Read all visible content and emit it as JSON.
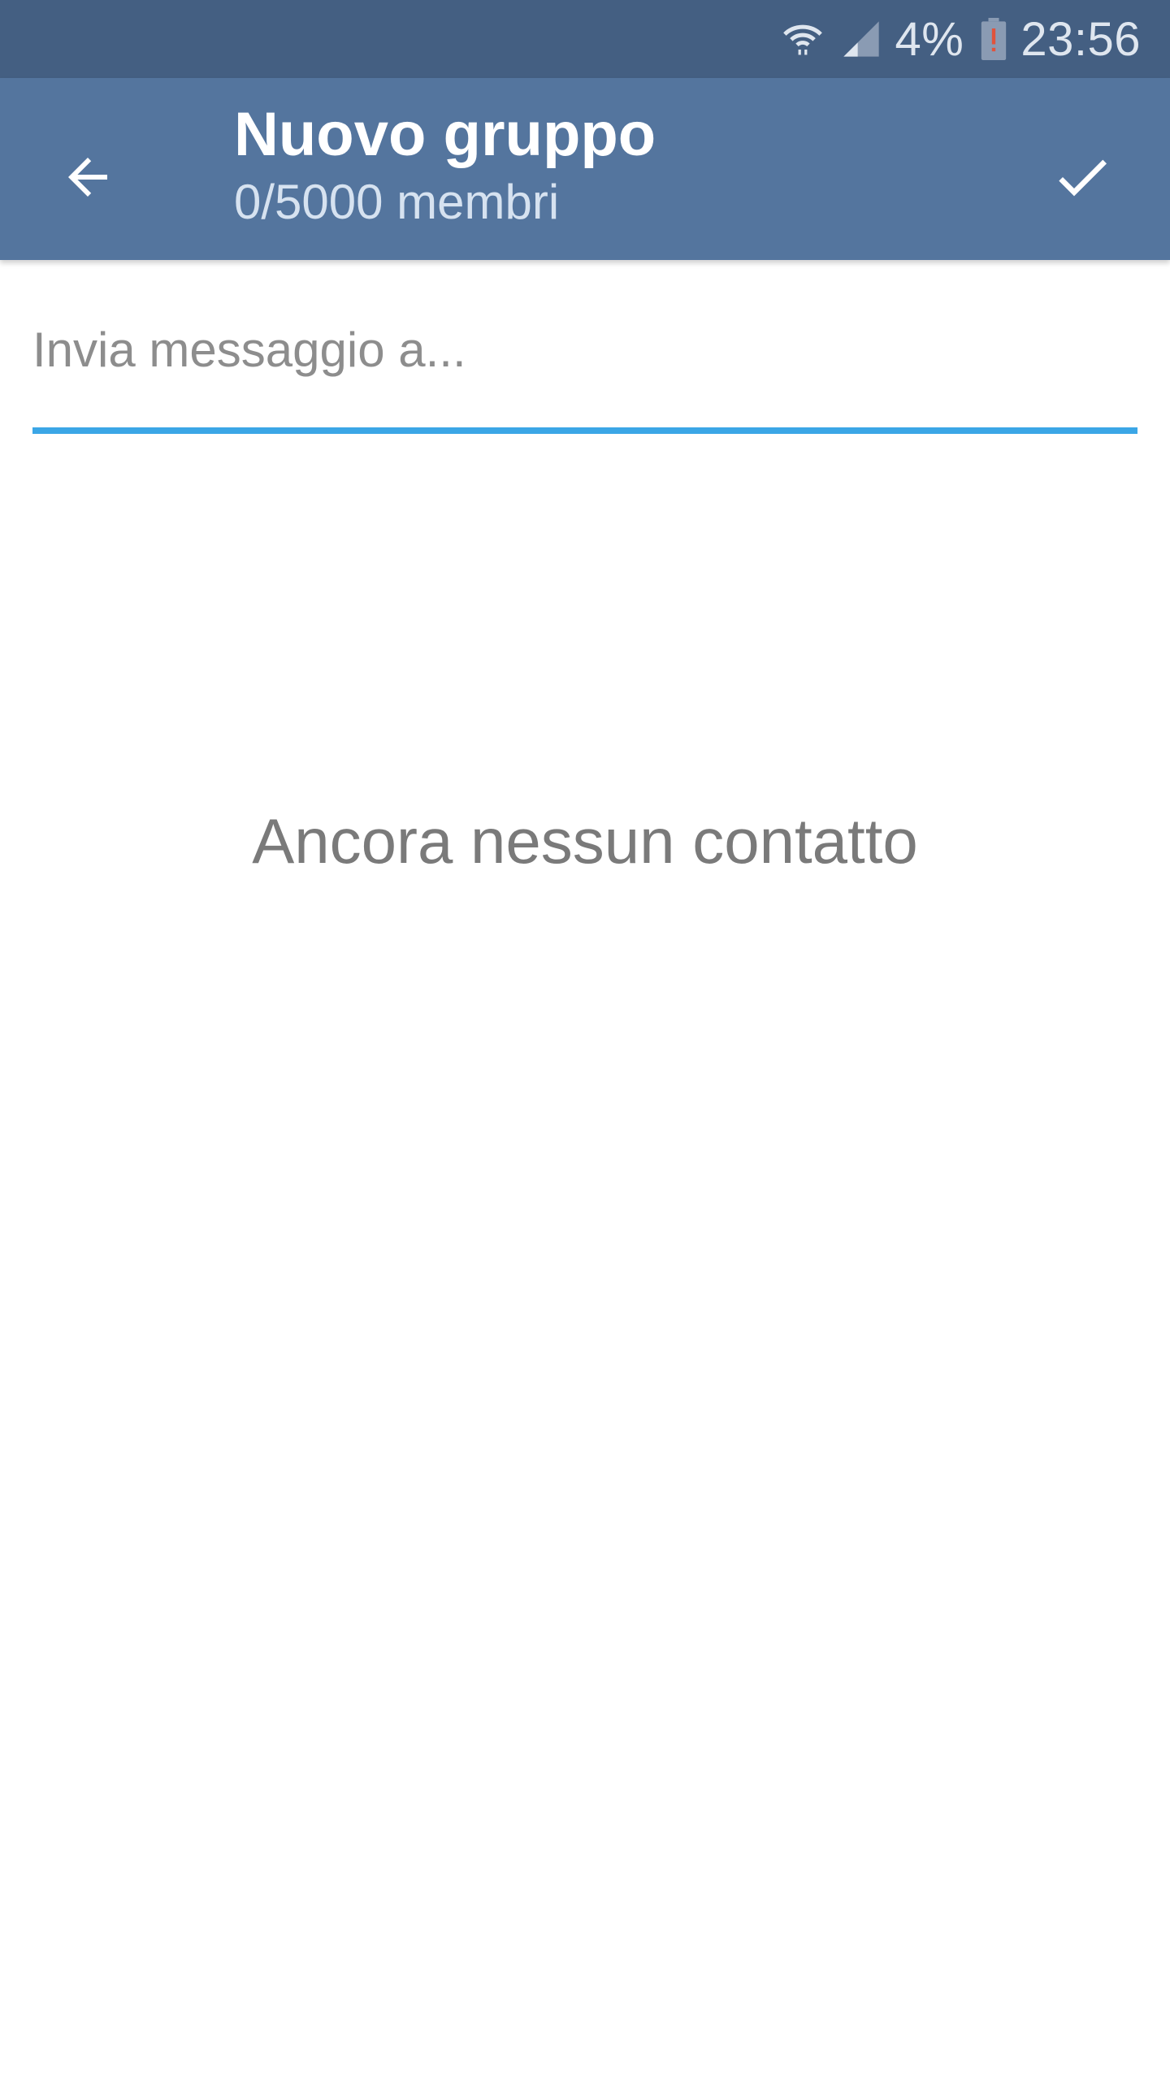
{
  "status_bar": {
    "battery": "4%",
    "time": "23:56",
    "icons": [
      "wifi-icon",
      "signal-icon",
      "battery-low-icon"
    ]
  },
  "app_bar": {
    "title": "Nuovo gruppo",
    "subtitle": "0/5000 membri",
    "back_icon": "arrow-back-icon",
    "done_icon": "check-icon",
    "background": "#54759e"
  },
  "recipient": {
    "placeholder": "Invia messaggio a...",
    "value": "",
    "accent": "#3ba6e6"
  },
  "empty_state": {
    "text": "Ancora nessun contatto"
  }
}
